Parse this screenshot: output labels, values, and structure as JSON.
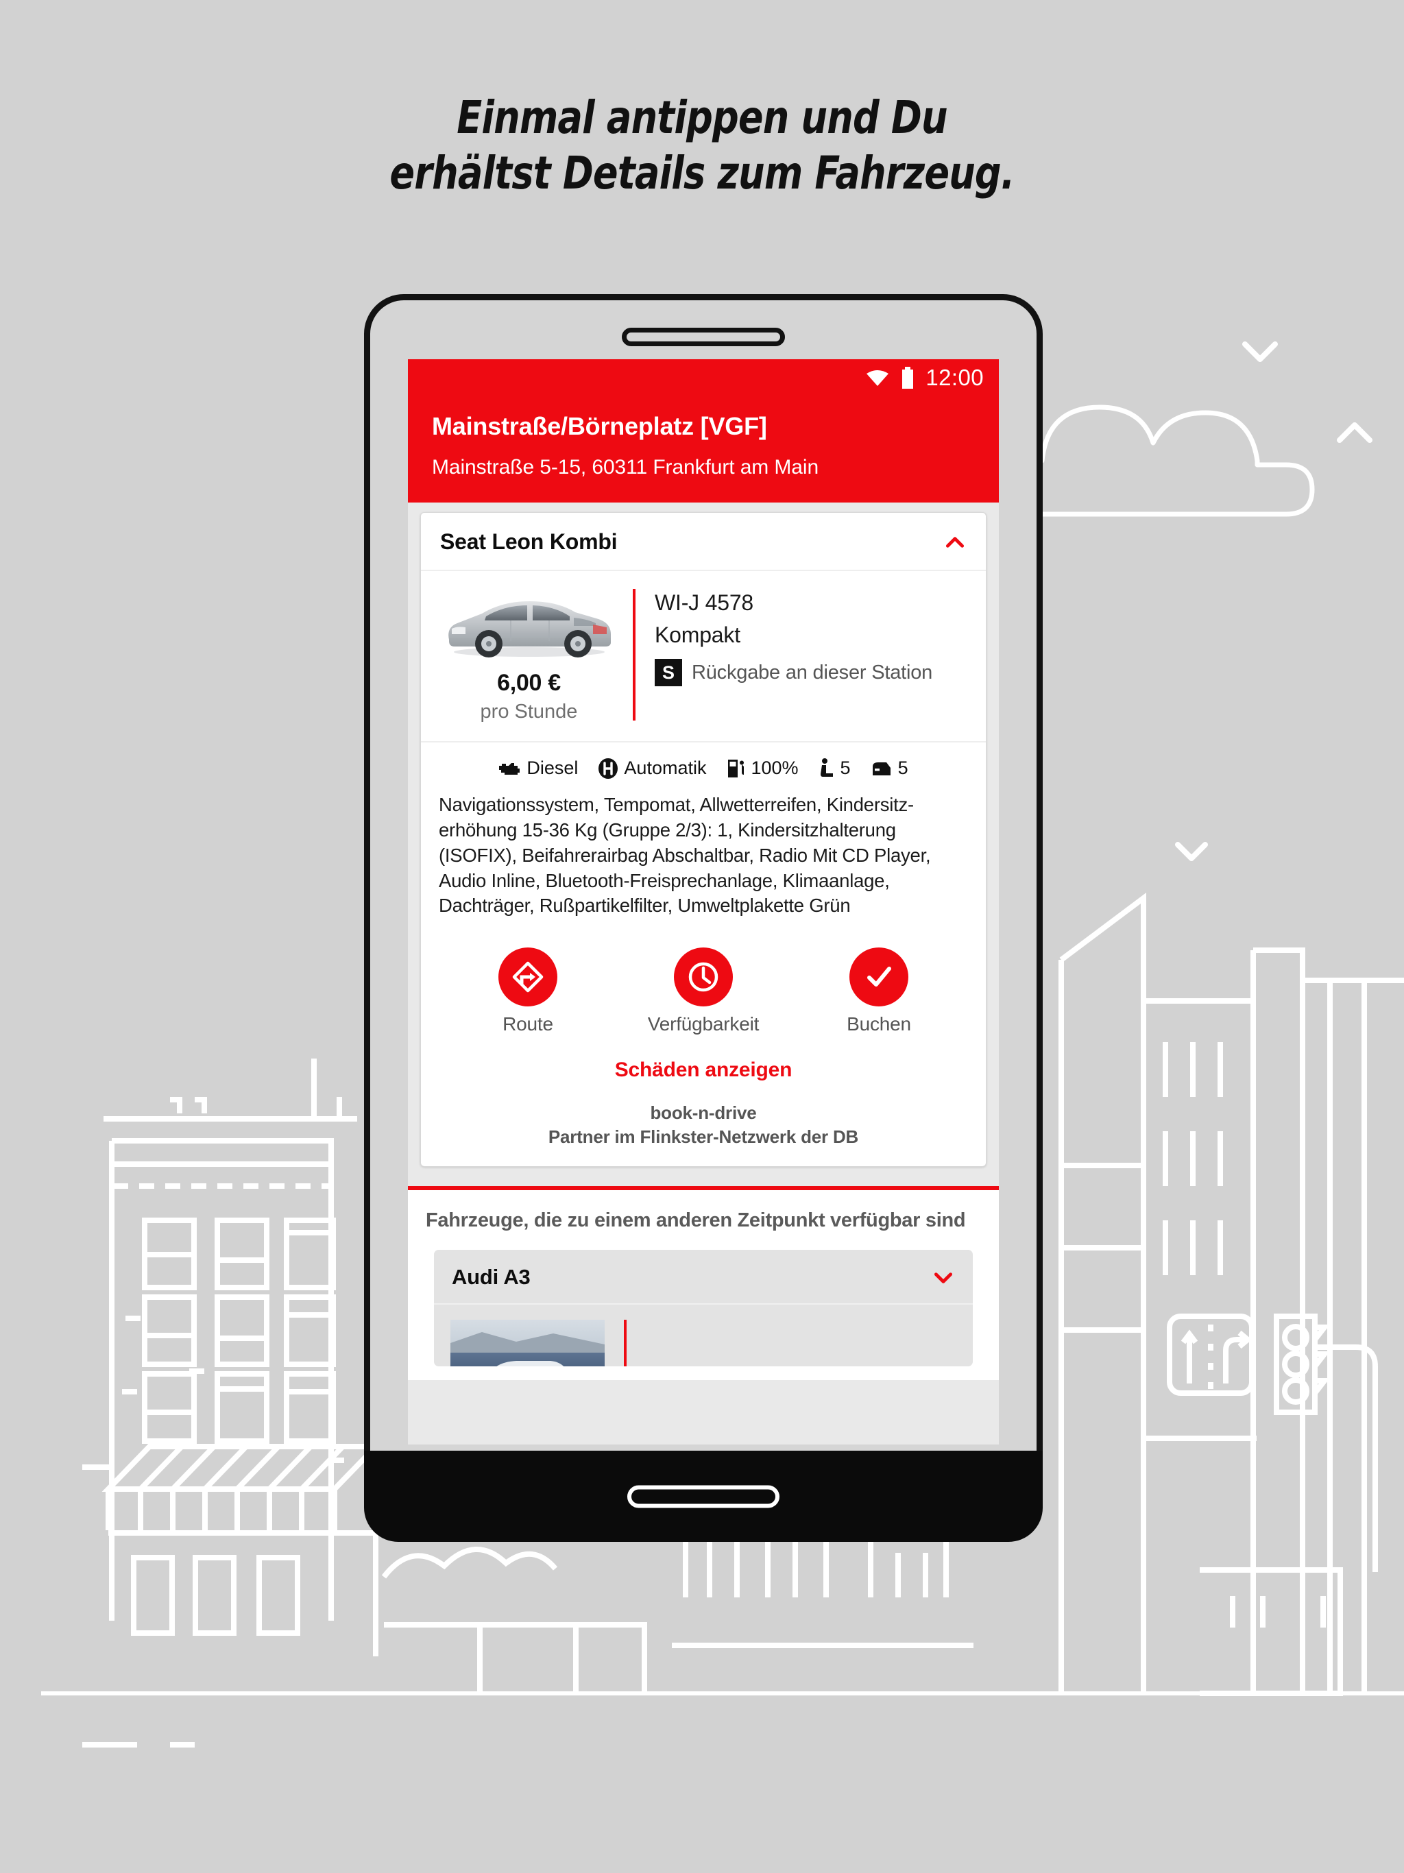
{
  "headline": {
    "line1": "Einmal antippen und Du",
    "line2": "erhältst Details zum Fahrzeug."
  },
  "colors": {
    "brand_red": "#ee0a12",
    "page_background": "#d2d2d2",
    "card_background": "#ffffff",
    "screen_background": "#e9e9e9",
    "text_dark": "#111111",
    "text_grey": "#555555"
  },
  "statusbar": {
    "wifi_icon": "wifi-icon",
    "battery_icon": "battery-icon",
    "time": "12:00"
  },
  "app_header": {
    "station_name": "Mainstraße/Börneplatz [VGF]",
    "station_address": "Mainstraße 5-15, 60311 Frankfurt am Main"
  },
  "vehicle_card": {
    "title": "Seat Leon Kombi",
    "collapse_icon": "chevron-up-icon",
    "photo_alt": "silver-estate-car-photo",
    "price": "6,00 €",
    "price_unit": "pro Stunde",
    "plate": "WI-J 4578",
    "category": "Kompakt",
    "return_badge": "S",
    "return_text": "Rückgabe an dieser Station",
    "specs": [
      {
        "icon": "engine-icon",
        "label": "Diesel"
      },
      {
        "icon": "gearshift-icon",
        "label": "Automatik"
      },
      {
        "icon": "fuel-pump-icon",
        "label": "100%"
      },
      {
        "icon": "seat-icon",
        "label": "5"
      },
      {
        "icon": "car-door-icon",
        "label": "5"
      }
    ],
    "features": "Navigationssystem, Tempomat, Allwetterreifen, Kindersitz-erhöhung 15-36 Kg (Gruppe 2/3): 1, Kindersitzhalterung (ISOFIX), Beifahrerairbag Abschaltbar, Radio Mit CD Player, Audio Inline, Bluetooth-Freisprechanlage, Klimaanlage, Dachträger, Rußpartikelfilter, Umweltplakette Grün",
    "actions": [
      {
        "icon": "route-sign-icon",
        "label": "Route"
      },
      {
        "icon": "clock-icon",
        "label": "Verfügbarkeit"
      },
      {
        "icon": "checkmark-icon",
        "label": "Buchen"
      }
    ],
    "damages_link": "Schäden anzeigen",
    "provider_name": "book-n-drive",
    "provider_partner": "Partner im Flinkster-Netzwerk der DB"
  },
  "other_vehicles": {
    "section_title": "Fahrzeuge, die zu einem anderen Zeitpunkt verfügbar sind",
    "items": [
      {
        "title": "Audi A3",
        "expand_icon": "chevron-down-icon",
        "photo_alt": "blue-car-photo"
      }
    ]
  },
  "device": {
    "speaker": "phone-speaker-slot",
    "home_button": "phone-home-button"
  },
  "background_art": {
    "cloud": "cloud-line-icon",
    "birds": "bird-chevron-icon",
    "buildings": "city-buildings-line-art",
    "traffic_light": "traffic-light-icon",
    "lane_sign": "lane-direction-sign-icon"
  }
}
